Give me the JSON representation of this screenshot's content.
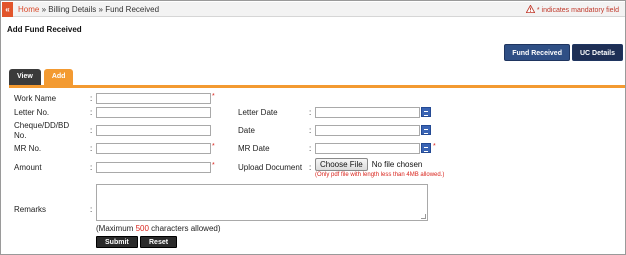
{
  "breadcrumb": {
    "home": "Home",
    "sep1": "»",
    "billing": "Billing Details",
    "sep2": "»",
    "current": "Fund Received",
    "collapse_glyph": "«"
  },
  "mandatory_note": "* indicates mandatory field",
  "page_title": "Add Fund Received",
  "top_buttons": {
    "fund_received": "Fund Received",
    "uc_details": "UC Details"
  },
  "tabs": {
    "view": "View",
    "add": "Add"
  },
  "form": {
    "colon": ":",
    "required_mark": "*",
    "work_name_label": "Work Name",
    "letter_no_label": "Letter No.",
    "letter_date_label": "Letter Date",
    "cheque_label_line1": "Cheque/DD/BD",
    "cheque_label_line2": "No.",
    "date_label": "Date",
    "mr_no_label": "MR No.",
    "mr_date_label": "MR Date",
    "amount_label": "Amount",
    "upload_label": "Upload Document",
    "choose_file": "Choose File",
    "no_file": "No file chosen",
    "pdf_note": "(Only pdf file with length less than 4MB allowed.)",
    "remarks_label": "Remarks",
    "max_prefix": "(Maximum ",
    "max_value": "500",
    "max_suffix": "  characters allowed)"
  },
  "actions": {
    "submit": "Submit",
    "reset": "Reset"
  },
  "colors": {
    "accent_orange": "#f39a31",
    "breadcrumb_home": "#d9492a",
    "required_red": "#d9241c",
    "button_blue": "#2f4f85"
  },
  "icons": {
    "warning": "warning-icon",
    "calendar": "calendar-icon",
    "collapse": "collapse-sidebar-icon"
  }
}
